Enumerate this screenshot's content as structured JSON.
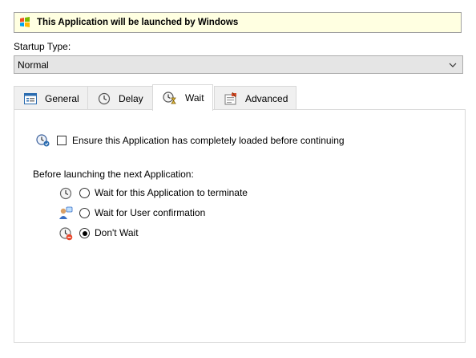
{
  "banner": {
    "text": "This Application will be launched by Windows",
    "icon": "windows-flag-icon"
  },
  "startup": {
    "label": "Startup Type:",
    "value": "Normal"
  },
  "tabs": [
    {
      "label": "General",
      "icon": "general-icon"
    },
    {
      "label": "Delay",
      "icon": "clock-icon"
    },
    {
      "label": "Wait",
      "icon": "hourglass-clock-icon",
      "active": true
    },
    {
      "label": "Advanced",
      "icon": "advanced-icon"
    }
  ],
  "wait": {
    "ensure_loaded": {
      "label": "Ensure this Application has completely loaded before continuing",
      "checked": false
    },
    "section_label": "Before launching the next Application:",
    "options": [
      {
        "label": "Wait for this Application to terminate",
        "selected": false,
        "icon": "clock-icon"
      },
      {
        "label": "Wait for User confirmation",
        "selected": false,
        "icon": "user-icon"
      },
      {
        "label": "Don't Wait",
        "selected": true,
        "icon": "no-wait-icon"
      }
    ]
  },
  "colors": {
    "banner_bg": "#ffffe1",
    "select_bg": "#e5e5e5",
    "tab_bg": "#f0f0f0"
  }
}
